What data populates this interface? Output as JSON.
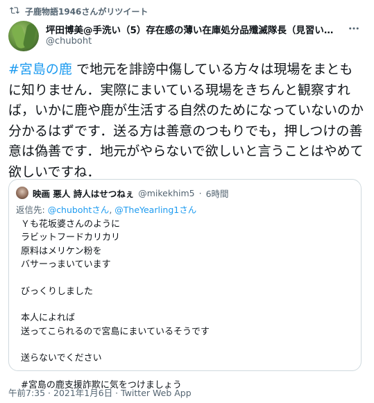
{
  "retweet": {
    "icon": "retweet-icon",
    "label": "子鹿物語1946さんがリツイート"
  },
  "author": {
    "avatar": "avatar",
    "name": "坪田博美@手洗い（5）存在感の薄い在庫処分品殲滅隊長（見習い…",
    "handle": "@chuboht",
    "more_icon": "more-icon"
  },
  "tweet": {
    "hashtag": "#宮島の鹿",
    "text": " で地元を誹謗中傷している方々は現場をまともに知りません．実際にまいている現場をきちんと観察すれば，いかに鹿や鹿が生活する自然のためになっていないのか分かるはずです．送る方は善意のつもりでも，押しつけの善意は偽善です．地元がやらないで欲しいと言うことはやめて欲しいですね．"
  },
  "quote": {
    "name": "映画 悪人 詩人はせつねぇ",
    "handle": "@mikekhim5",
    "separator": "·",
    "time": "6時間",
    "reply_prefix": "返信先: ",
    "reply_mention_1": "@chubohtさん",
    "reply_sep": ", ",
    "reply_mention_2": "@TheYearling1さん",
    "lines": [
      "Ｙも花坂婆さんのように",
      "ラビットフードカリカリ",
      "原料はメリケン粉を",
      "バサーっまいています",
      "",
      "びっくりしました",
      "",
      "本人によれば",
      "送ってこられるので宮島にまいているそうです",
      "",
      "送らないでください",
      "",
      "#宮島の鹿支援詐欺に気をつけましょう"
    ]
  },
  "footer": {
    "timestamp": "午前7:35 · 2021年1月6日 · Twitter Web App"
  },
  "colors": {
    "link": "#1d9bf0",
    "secondary_text": "#536471",
    "primary_text": "#0f1419",
    "border": "#cfd9de"
  }
}
